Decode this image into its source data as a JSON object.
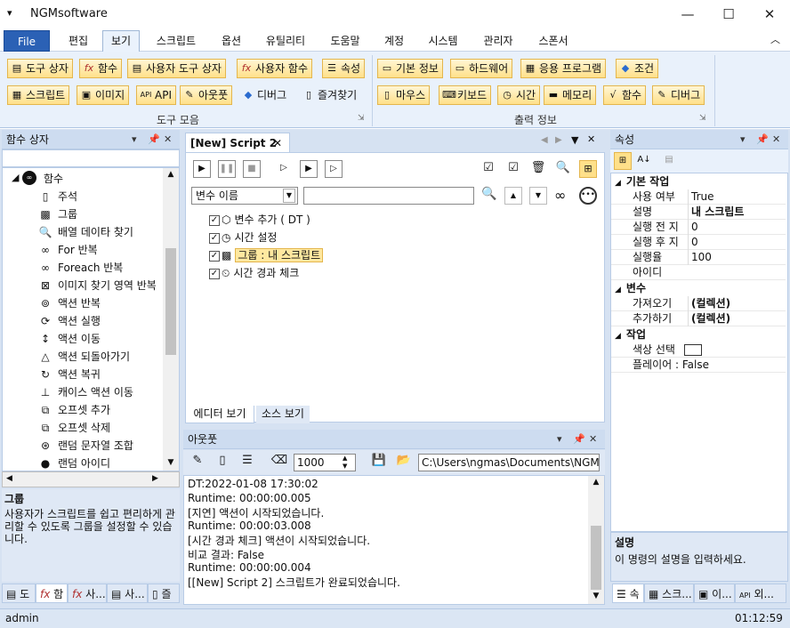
{
  "app": {
    "title": "NGMsoftware"
  },
  "menu": {
    "items": [
      "File",
      "편집",
      "보기",
      "스크립트",
      "옵션",
      "유틸리티",
      "도움말",
      "계정",
      "시스템",
      "관리자",
      "스폰서"
    ]
  },
  "ribbon": {
    "group1_row1": [
      "도구 상자",
      "함수",
      "사용자 도구 상자",
      "사용자 함수",
      "속성"
    ],
    "group1_row2": [
      "스크립트",
      "이미지",
      "API",
      "아웃풋",
      "디버그",
      "즐겨찾기"
    ],
    "group1_label": "도구 모음",
    "group2_row1": [
      "기본 정보",
      "하드웨어",
      "응용 프로그램",
      "조건"
    ],
    "group2_row2": [
      "마우스",
      "키보드",
      "시간",
      "메모리",
      "함수",
      "디버그"
    ],
    "group2_label": "출력 정보"
  },
  "left_panel": {
    "title": "함수 상자",
    "root": "함수",
    "items": [
      {
        "icon": "comment-icon",
        "label": "주석"
      },
      {
        "icon": "group-icon",
        "label": "그룹"
      },
      {
        "icon": "search-icon",
        "label": "배열 데이타 찾기"
      },
      {
        "icon": "loop-icon",
        "label": "For 반복"
      },
      {
        "icon": "loop-icon",
        "label": "Foreach 반복"
      },
      {
        "icon": "image-find-icon",
        "label": "이미지 찾기 영역 반복"
      },
      {
        "icon": "repeat-icon",
        "label": "액션 반복"
      },
      {
        "icon": "run-icon",
        "label": "액션 실행"
      },
      {
        "icon": "move-icon",
        "label": "액션 이동"
      },
      {
        "icon": "revert-icon",
        "label": "액션 되돌아가기"
      },
      {
        "icon": "restore-icon",
        "label": "액션 복귀"
      },
      {
        "icon": "case-icon",
        "label": "캐이스 액션 이동"
      },
      {
        "icon": "offset-add-icon",
        "label": "오프셋 추가"
      },
      {
        "icon": "offset-delete-icon",
        "label": "오프셋 삭제"
      },
      {
        "icon": "random-icon",
        "label": "랜덤 문자열 조합"
      },
      {
        "icon": "random-id-icon",
        "label": "랜덤 아이디"
      }
    ],
    "desc_title": "그룹",
    "desc_text": "사용자가 스크립트를 쉽고 편리하게 관리할 수 있도록 그룹을 설정할 수 있습니다.",
    "tabs": [
      "도",
      "함",
      "사...",
      "사...",
      "즐"
    ]
  },
  "editor": {
    "tab": "[New] Script 2",
    "var_select": "변수 이름",
    "nodes": [
      "변수 추가 ( DT )",
      "시간 설정",
      "그룹 : 내 스크립트",
      "시간 경과 체크"
    ],
    "tabs": [
      "에디터 보기",
      "소스 보기"
    ]
  },
  "output": {
    "title": "아웃풋",
    "count": "1000",
    "path": "C:\\Users\\ngmas\\Documents\\NGM6\\",
    "lines": [
      "DT:2022-01-08 17:30:02",
      "Runtime: 00:00:00.005",
      "[지연] 액션이 시작되었습니다.",
      "Runtime: 00:00:03.008",
      "[시간 경과 체크] 액션이 시작되었습니다.",
      "비교 결과: False",
      "Runtime: 00:00:00.004",
      "[[New] Script 2] 스크립트가 완료되었습니다."
    ]
  },
  "props": {
    "title": "속성",
    "cat1": "기본 작업",
    "rows1": [
      [
        "사용 여부",
        "True"
      ],
      [
        "설명",
        "내 스크립트"
      ],
      [
        "실행 전 지",
        "0"
      ],
      [
        "실행 후 지",
        "0"
      ],
      [
        "실행율",
        "100"
      ],
      [
        "아이디",
        ""
      ]
    ],
    "cat2": "변수",
    "rows2": [
      [
        "가져오기",
        "(컬렉션)"
      ],
      [
        "추가하기",
        "(컬렉션)"
      ]
    ],
    "cat3": "작업",
    "rows3": [
      [
        "색상 선택",
        ""
      ],
      [
        "플레이어 : False",
        ""
      ]
    ],
    "desc_title": "설명",
    "desc_text": "이 명령의 설명을 입력하세요.",
    "tabs": [
      "속",
      "스크...",
      "이...",
      "외..."
    ]
  },
  "status": {
    "user": "admin",
    "time": "01:12:59"
  }
}
